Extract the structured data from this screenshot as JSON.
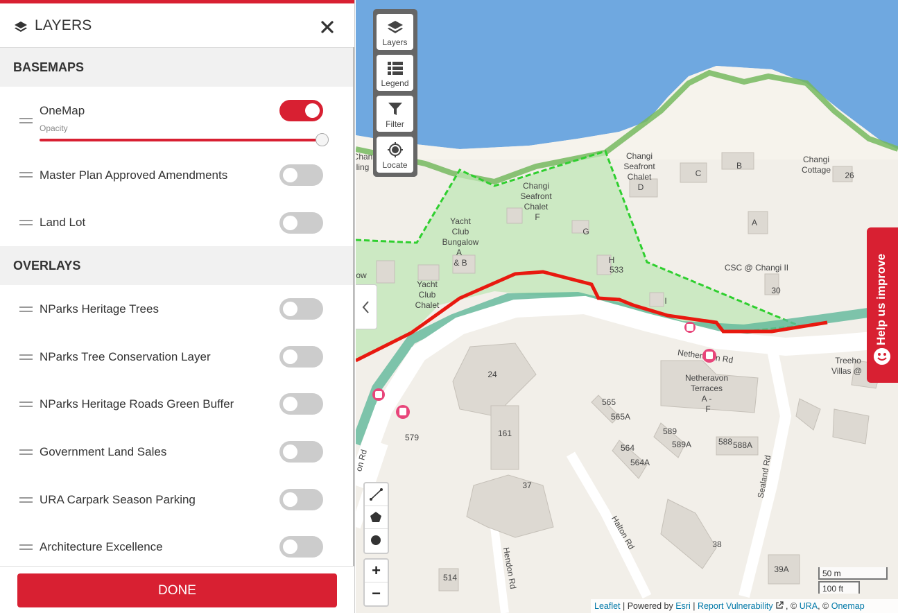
{
  "panel": {
    "title": "LAYERS",
    "basemaps": {
      "heading": "BASEMAPS",
      "items": [
        {
          "label": "OneMap",
          "on": true,
          "opacity_label": "Opacity",
          "opacity": 1.0
        },
        {
          "label": "Master Plan Approved Amendments",
          "on": false
        },
        {
          "label": "Land Lot",
          "on": false
        }
      ]
    },
    "overlays": {
      "heading": "OVERLAYS",
      "items": [
        {
          "label": "NParks Heritage Trees",
          "on": false
        },
        {
          "label": "NParks Tree Conservation Layer",
          "on": false
        },
        {
          "label": "NParks Heritage Roads Green Buffer",
          "on": false
        },
        {
          "label": "Government Land Sales",
          "on": false
        },
        {
          "label": "URA Carpark Season Parking",
          "on": false
        },
        {
          "label": "Architecture Excellence",
          "on": false
        }
      ]
    },
    "done_label": "DONE",
    "accent": "#d82032"
  },
  "map": {
    "controls": [
      {
        "label": "Layers",
        "icon": "layers-icon"
      },
      {
        "label": "Legend",
        "icon": "list-icon"
      },
      {
        "label": "Filter",
        "icon": "filter-icon"
      },
      {
        "label": "Locate",
        "icon": "locate-icon"
      }
    ],
    "help_label": "Help us improve",
    "zoom_in": "+",
    "zoom_out": "−",
    "scale": {
      "metric": "50 m",
      "imperial": "100 ft"
    },
    "attribution": {
      "leaflet": "Leaflet",
      "powered_by": " | Powered by ",
      "esri": "Esri",
      "sep1": " | ",
      "report": "Report Vulnerability",
      "copy1": " , © ",
      "ura": "URA",
      "copy2": ", © ",
      "onemap": "Onemap"
    },
    "labels": {
      "changi_seafront_chalet_d": [
        "Changi",
        "Seafront",
        "Chalet",
        "D"
      ],
      "changi_seafront_chalet_f": [
        "Changi",
        "Seafront",
        "Chalet",
        "F"
      ],
      "yacht_club_bungalow": [
        "Yacht",
        "Club",
        "Bungalow",
        "A",
        "& B"
      ],
      "yacht_club_chalet": [
        "Yacht",
        "Club",
        "Chalet"
      ],
      "changi_cottage": [
        "Changi",
        "Cottage"
      ],
      "csc": "CSC @ Changi II",
      "netheravon_rd": "Netheravon Rd",
      "netheravon_terraces": [
        "Netheravon",
        "Terraces",
        "A -",
        "F"
      ],
      "treehouse_villas": [
        "Treeho",
        "Villas @"
      ],
      "halton_rd": "Halton Rd",
      "hendon_rd": "Hendon Rd",
      "sealand_rd": "Sealand Rd",
      "on_rd": "on Rd",
      "chalet_partial": [
        "Chan",
        "ling"
      ],
      "ow": "ow",
      "bldg": {
        "c": "C",
        "b": "B",
        "a": "A",
        "g": "G",
        "h": "H",
        "n533": "533",
        "n26": "26",
        "n30": "30",
        "i": "I",
        "n24": "24",
        "n161": "161",
        "n37": "37",
        "n579": "579",
        "n565": "565",
        "n565a": "565A",
        "n564": "564",
        "n564a": "564A",
        "n589": "589",
        "n589a": "589A",
        "n588": "588",
        "n588a": "588A",
        "n38": "38",
        "n39a": "39A",
        "n514": "514"
      }
    }
  }
}
